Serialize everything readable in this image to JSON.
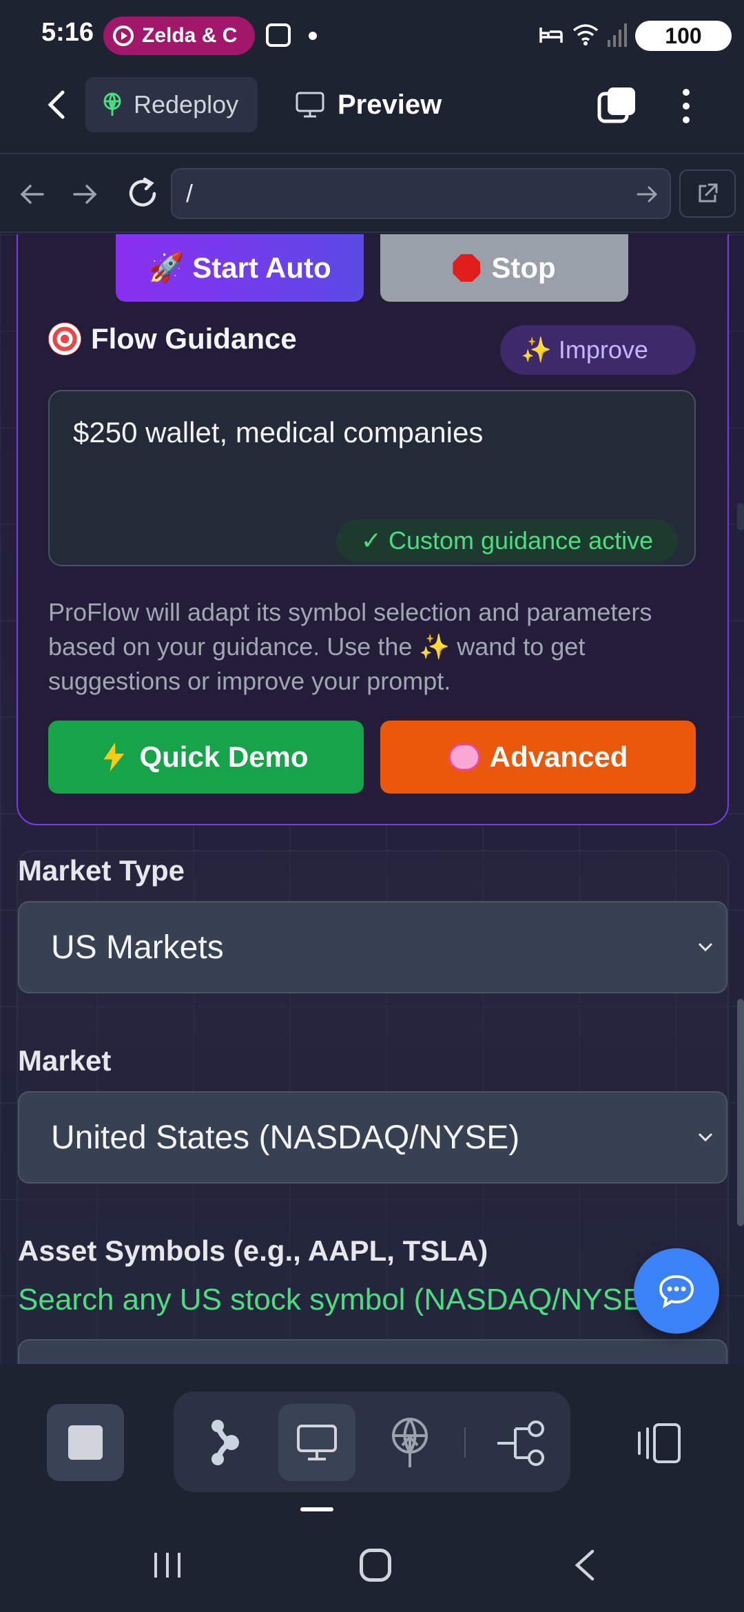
{
  "status_bar": {
    "time": "5:16",
    "media_chip": "Zelda & C",
    "battery": "100"
  },
  "app_bar": {
    "redeploy_label": "Redeploy",
    "preview_label": "Preview"
  },
  "browser": {
    "url": "/"
  },
  "flow_card": {
    "start_auto_label": "🚀 Start Auto",
    "stop_label": "Stop",
    "title": "Flow Guidance",
    "improve_label": "✨ Improve",
    "guidance_value": "$250 wallet, medical companies",
    "guidance_badge": "✓ Custom guidance active",
    "help_text": "ProFlow will adapt its symbol selection and parameters based on your guidance. Use the ✨ wand to get suggestions or improve your prompt.",
    "quick_demo_label": "Quick Demo",
    "advanced_label": "Advanced"
  },
  "settings": {
    "market_type_label": "Market Type",
    "market_type_value": "US Markets",
    "market_label": "Market",
    "market_value": "United States (NASDAQ/NYSE)",
    "asset_label": "Asset Symbols (e.g., AAPL, TSLA)",
    "asset_hint": "Search any US stock symbol (NASDAQ/NYSE)"
  },
  "colors": {
    "accent_purple": "#7c3aed",
    "success_green": "#16a34a",
    "advanced_orange": "#ea580c",
    "fab_blue": "#3b82f6"
  }
}
